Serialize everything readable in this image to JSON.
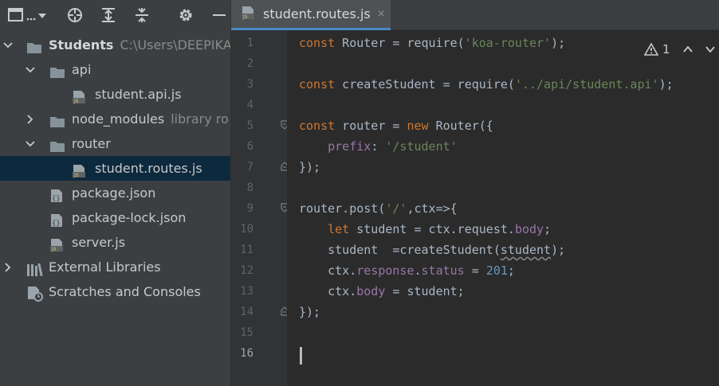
{
  "project": {
    "tree": [
      {
        "label": "Students",
        "hint": "C:\\Users\\DEEPIKA\\",
        "icon": "folder-icon",
        "expanded": true
      },
      {
        "label": "api",
        "hint": "",
        "icon": "folder-icon",
        "expanded": true
      },
      {
        "label": "student.api.js",
        "hint": "",
        "icon": "js-file-icon"
      },
      {
        "label": "node_modules",
        "hint": "library ro",
        "icon": "folder-icon",
        "expanded": false
      },
      {
        "label": "router",
        "hint": "",
        "icon": "folder-icon",
        "expanded": true
      },
      {
        "label": "student.routes.js",
        "hint": "",
        "icon": "js-file-icon",
        "selected": true
      },
      {
        "label": "package.json",
        "hint": "",
        "icon": "json-file-icon"
      },
      {
        "label": "package-lock.json",
        "hint": "",
        "icon": "json-file-icon"
      },
      {
        "label": "server.js",
        "hint": "",
        "icon": "js-file-icon"
      },
      {
        "label": "External Libraries",
        "hint": "",
        "icon": "library-icon",
        "expanded": false
      },
      {
        "label": "Scratches and Consoles",
        "hint": "",
        "icon": "scratches-icon"
      }
    ]
  },
  "editor": {
    "tab_label": "student.routes.js",
    "tab_close": "×",
    "inspection_count": "1",
    "current_line": 16,
    "line_numbers": [
      "1",
      "2",
      "3",
      "4",
      "5",
      "6",
      "7",
      "8",
      "9",
      "10",
      "11",
      "12",
      "13",
      "14",
      "15",
      "16"
    ],
    "code_lines": [
      "const Router = require('koa-router');",
      "",
      "const createStudent = require('../api/student.api');",
      "",
      "const router = new Router({",
      "    prefix: '/student'",
      "});",
      "",
      "router.post('/',ctx=>{",
      "    let student = ctx.request.body;",
      "    student  =createStudent(student);",
      "    ctx.response.status = 201;",
      "    ctx.body = student;",
      "});",
      "",
      ""
    ]
  },
  "colors": {
    "panel_bg": "#3c3f41",
    "editor_bg": "#2b2b2b",
    "selection": "#0d293e",
    "keyword": "#cc7832",
    "string": "#6a8759",
    "number": "#6897bb",
    "property": "#9876aa"
  }
}
